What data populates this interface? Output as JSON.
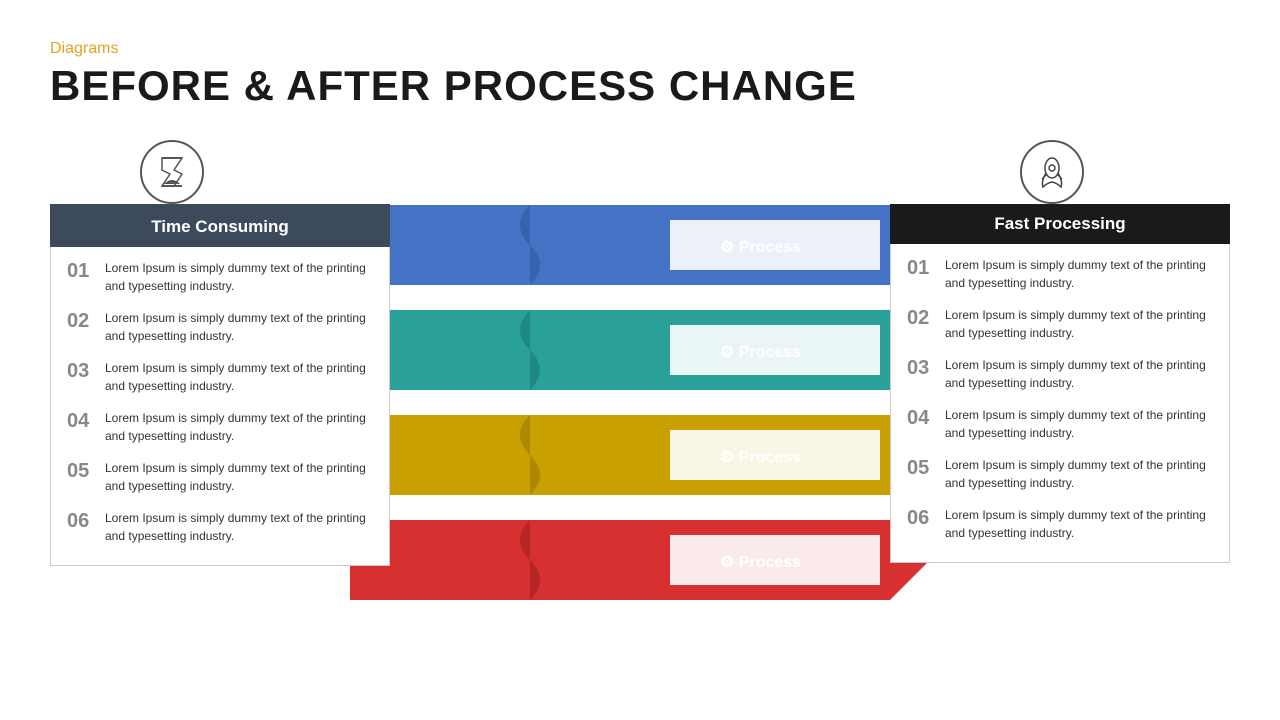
{
  "header": {
    "category": "Diagrams",
    "title": "BEFORE & AFTER PROCESS CHANGE"
  },
  "left_panel": {
    "title": "Time Consuming",
    "items": [
      {
        "num": "01",
        "text": "Lorem Ipsum is simply dummy text of the printing and typesetting industry."
      },
      {
        "num": "02",
        "text": "Lorem Ipsum is simply dummy text of the printing and typesetting industry."
      },
      {
        "num": "03",
        "text": "Lorem Ipsum is simply dummy text of the printing and typesetting industry."
      },
      {
        "num": "04",
        "text": "Lorem Ipsum is simply dummy text of the printing and typesetting industry."
      },
      {
        "num": "05",
        "text": "Lorem Ipsum is simply dummy text of the printing and typesetting industry."
      },
      {
        "num": "06",
        "text": "Lorem Ipsum is simply dummy text of the printing and typesetting industry."
      }
    ]
  },
  "process_labels": [
    "Process",
    "Process",
    "Process",
    "Process"
  ],
  "right_panel": {
    "title": "Fast Processing",
    "items": [
      {
        "num": "01",
        "text": "Lorem Ipsum is simply dummy text of the printing and typesetting industry."
      },
      {
        "num": "02",
        "text": "Lorem Ipsum is simply dummy text of the printing and typesetting industry."
      },
      {
        "num": "03",
        "text": "Lorem Ipsum is simply dummy text of the printing and typesetting industry."
      },
      {
        "num": "04",
        "text": "Lorem Ipsum is simply dummy text of the printing and typesetting industry."
      },
      {
        "num": "05",
        "text": "Lorem Ipsum is simply dummy text of the printing and typesetting industry."
      },
      {
        "num": "06",
        "text": "Lorem Ipsum is simply dummy text of the printing and typesetting industry."
      }
    ]
  },
  "colors": {
    "arrow1": "#4472c4",
    "arrow2": "#2aa198",
    "arrow3": "#c8a000",
    "arrow4": "#d63030",
    "left_header_bg": "#3d4a5c",
    "right_header_bg": "#1a1a1a",
    "category": "#e8a020"
  }
}
